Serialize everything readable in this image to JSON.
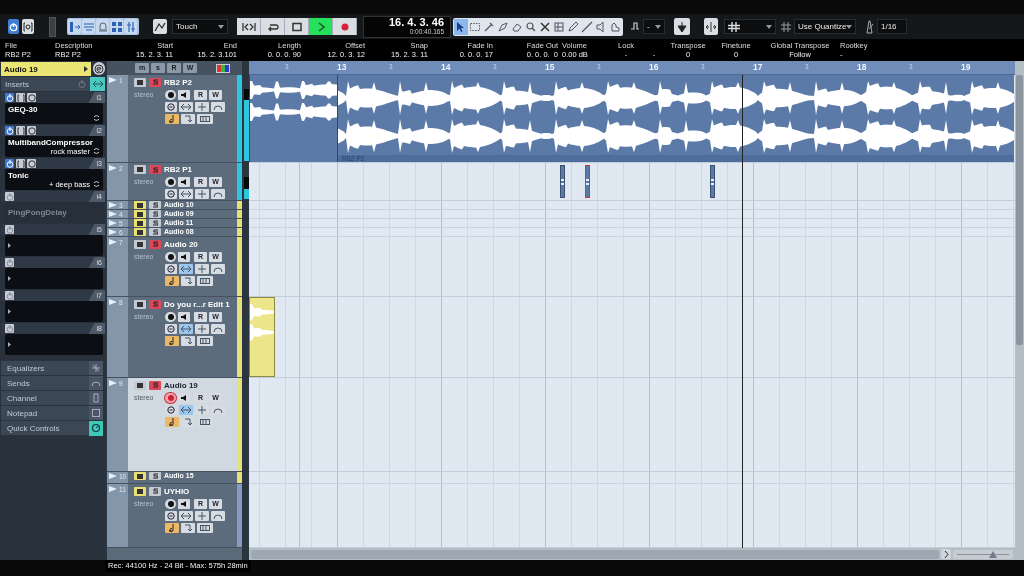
{
  "toolbar": {
    "automation_mode": "Touch",
    "transport": [
      {
        "kind": "locate",
        "selected": false
      },
      {
        "kind": "cycle",
        "selected": false
      },
      {
        "kind": "stop",
        "selected": false
      },
      {
        "kind": "play",
        "selected": true
      },
      {
        "kind": "record",
        "selected": false
      }
    ],
    "position": {
      "primary": "16. 4. 3. 46",
      "secondary": "0:00:40.165"
    },
    "tools": [
      {
        "kind": "pointer",
        "selected": true
      },
      {
        "kind": "range",
        "selected": false
      },
      {
        "kind": "split",
        "selected": false
      },
      {
        "kind": "glue",
        "selected": false
      },
      {
        "kind": "erase",
        "selected": false
      },
      {
        "kind": "zoom",
        "selected": false
      },
      {
        "kind": "mute",
        "selected": false
      },
      {
        "kind": "comp",
        "selected": false
      },
      {
        "kind": "draw",
        "selected": false
      },
      {
        "kind": "line",
        "selected": false
      },
      {
        "kind": "play",
        "selected": false
      },
      {
        "kind": "scrub",
        "selected": false
      }
    ],
    "snap_type": "-",
    "quantize_type": "Use Quantize",
    "quantize_value": "1/16"
  },
  "info_line": [
    {
      "label": "File",
      "value": "RB2 P2"
    },
    {
      "label": "Description",
      "value": "RB2 P2"
    },
    {
      "label": "Start",
      "value": "15. 2. 3. 11"
    },
    {
      "label": "End",
      "value": "15. 2. 3.101"
    },
    {
      "label": "Length",
      "value": "0. 0. 0. 90"
    },
    {
      "label": "Offset",
      "value": "12. 0. 3. 12"
    },
    {
      "label": "Snap",
      "value": "15. 2. 3. 11"
    },
    {
      "label": "Fade In",
      "value": "0. 0. 0. 17"
    },
    {
      "label": "Fade Out",
      "value": "0. 0. 0.  0"
    },
    {
      "label": "Volume",
      "value": "0.00 dB"
    },
    {
      "label": "Lock",
      "value": "-"
    },
    {
      "value": "-"
    },
    {
      "label": "Transpose",
      "value": "0"
    },
    {
      "label": "Finetune",
      "value": "0"
    },
    {
      "label": "Global Transpose",
      "value": "Follow"
    },
    {
      "label": "Rootkey",
      "value": "-"
    }
  ],
  "inspector": {
    "track_name": "Audio 19",
    "inserts_label": "Inserts",
    "inserts": [
      {
        "number": "i1",
        "plugin": "GEQ-30",
        "active": true
      },
      {
        "number": "i2",
        "plugin": "MultibandCompressor",
        "preset": "rock master",
        "active": true
      },
      {
        "number": "i3",
        "plugin": "Tonic",
        "preset": "+ deep bass",
        "active": true
      },
      {
        "number": "i4",
        "plugin": "PingPongDelay",
        "active": false
      },
      {
        "number": "i5"
      },
      {
        "number": "i6"
      },
      {
        "number": "i7"
      },
      {
        "number": "i8"
      }
    ],
    "sections": [
      {
        "label": "Equalizers",
        "kind": "eq"
      },
      {
        "label": "Sends",
        "kind": "sends"
      },
      {
        "label": "Channel",
        "kind": "channel"
      },
      {
        "label": "Notepad",
        "kind": "notepad"
      },
      {
        "label": "Quick Controls",
        "kind": "quick"
      }
    ]
  },
  "track_list": {
    "header_buttons": [
      "m",
      "s",
      "R",
      "W"
    ],
    "tracks": [
      {
        "number": "1",
        "name": "RB2 P2",
        "kind": "expanded",
        "subtitle": "stereo",
        "automation_buttons": [
          "R",
          "W"
        ],
        "muted": false,
        "soloed": true,
        "record_enabled": false,
        "selected": false,
        "color": "#2ec6de",
        "level": 0.85,
        "events": [
          {
            "kind": "audio",
            "color": "#5b7aa8",
            "selected": false
          },
          {
            "kind": "audio",
            "name": "RB2 P2",
            "color": "#5b7aa8",
            "selected": false
          }
        ]
      },
      {
        "number": "2",
        "name": "RB2 P1",
        "kind": "expanded",
        "subtitle": "stereo",
        "automation_buttons": [
          "R",
          "W"
        ],
        "muted": false,
        "soloed": true,
        "record_enabled": false,
        "selected": false,
        "color": "#2ec6de",
        "level": 0.45,
        "events": [
          {
            "kind": "part",
            "color": "#5b7aa8",
            "selected": false
          },
          {
            "kind": "part",
            "color": "#5b7aa8",
            "selected": true
          },
          {
            "kind": "part",
            "color": "#5b7aa8",
            "selected": false
          }
        ]
      },
      {
        "number": "3",
        "name": "Audio 10",
        "kind": "collapsed",
        "muted": true,
        "soloed": false,
        "selected": false,
        "color": "#e4e07a"
      },
      {
        "number": "4",
        "name": "Audio 09",
        "kind": "collapsed",
        "muted": true,
        "soloed": false,
        "selected": false,
        "color": "#e4e07a"
      },
      {
        "number": "5",
        "name": "Audio 11",
        "kind": "collapsed",
        "muted": true,
        "soloed": false,
        "selected": false,
        "color": "#e4e07a"
      },
      {
        "number": "6",
        "name": "Audio 08",
        "kind": "collapsed",
        "muted": true,
        "soloed": false,
        "selected": false,
        "color": "#e4e07a"
      },
      {
        "number": "7",
        "name": "Audio 20",
        "kind": "expanded",
        "subtitle": "stereo",
        "automation_buttons": [
          "R",
          "W"
        ],
        "muted": false,
        "soloed": true,
        "record_enabled": false,
        "selected": false,
        "color": "#e4e07a"
      },
      {
        "number": "8",
        "name": "Do you r...r Edit 1",
        "kind": "expanded",
        "subtitle": "stereo",
        "automation_buttons": [
          "R",
          "W"
        ],
        "muted": false,
        "soloed": true,
        "record_enabled": false,
        "selected": false,
        "color": "#e4e07a",
        "events": [
          {
            "kind": "audio",
            "color": "#ece58a",
            "selected": false
          }
        ]
      },
      {
        "number": "9",
        "name": "Audio 19",
        "kind": "expanded",
        "subtitle": "stereo",
        "automation_buttons": [
          "R",
          "W"
        ],
        "muted": false,
        "soloed": true,
        "record_enabled": true,
        "selected": true,
        "color": "#e4e07a"
      },
      {
        "number": "10",
        "name": "Audio 15",
        "kind": "collapsed",
        "muted": true,
        "soloed": false,
        "selected": false,
        "color": "#e4e07a"
      },
      {
        "number": "11",
        "name": "UYHIO",
        "kind": "expanded",
        "subtitle": "stereo",
        "automation_buttons": [
          "R",
          "W"
        ],
        "muted": true,
        "soloed": false,
        "record_enabled": false,
        "selected": false,
        "color": "#8a98c4"
      }
    ]
  },
  "zoom": {
    "level": 0.7
  },
  "ruler": [
    "3",
    "13",
    "3",
    "14",
    "3",
    "15",
    "3",
    "16",
    "3",
    "17",
    "3",
    "18",
    "3",
    "19"
  ],
  "status_bar": "Rec: 44100 Hz - 24 Bit - Max: 575h 28min"
}
